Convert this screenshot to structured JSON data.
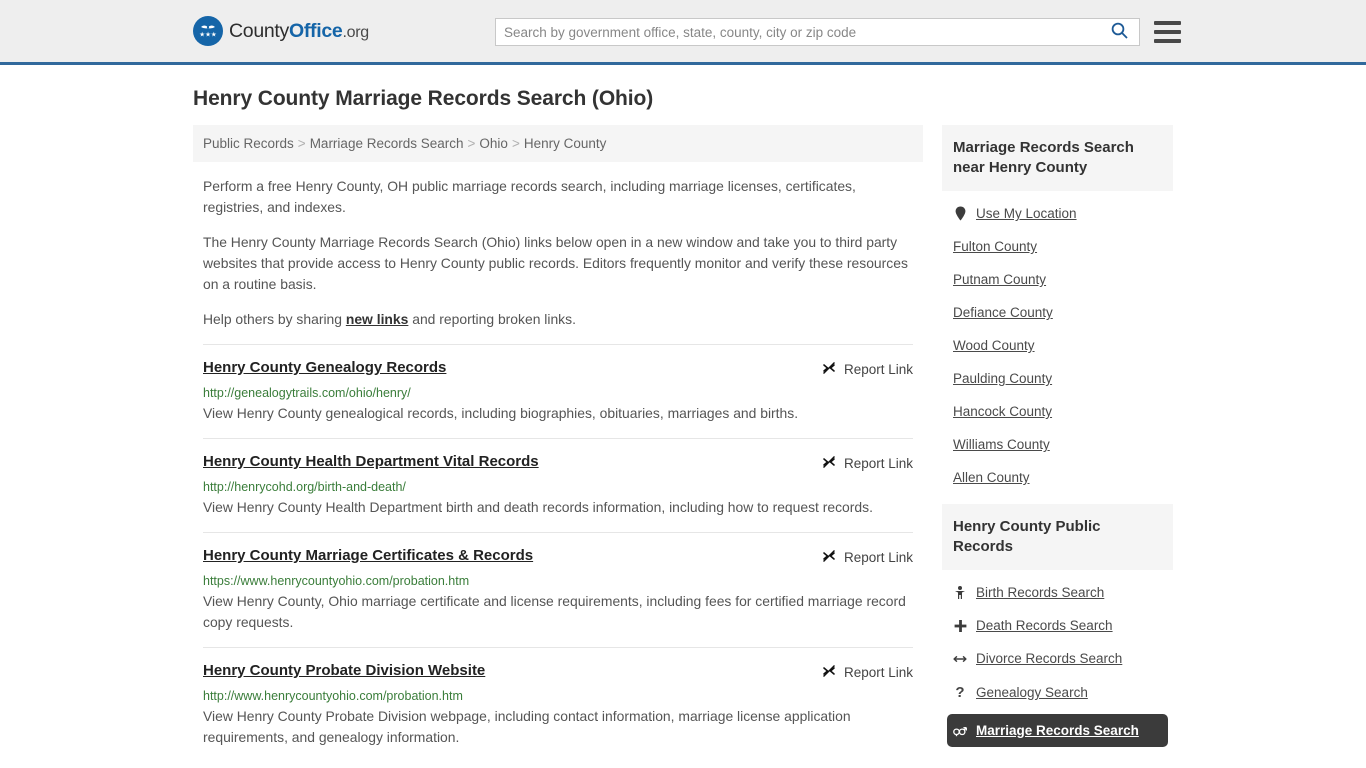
{
  "header": {
    "logo": {
      "part1": "County",
      "part2": "Office",
      "part3": ".org",
      "icon": "eagle-shield-logo"
    },
    "search": {
      "placeholder": "Search by government office, state, county, city or zip code",
      "value": "",
      "search_icon": "search-icon"
    },
    "menu_icon": "hamburger-menu-icon",
    "accent_color": "#31699c"
  },
  "page_title": "Henry County Marriage Records Search (Ohio)",
  "breadcrumb": {
    "separator": ">",
    "items": [
      {
        "label": "Public Records"
      },
      {
        "label": "Marriage Records Search"
      },
      {
        "label": "Ohio"
      },
      {
        "label": "Henry County"
      }
    ]
  },
  "intro": {
    "p1": "Perform a free Henry County, OH public marriage records search, including marriage licenses, certificates, registries, and indexes.",
    "p2": "The Henry County Marriage Records Search (Ohio) links below open in a new window and take you to third party websites that provide access to Henry County public records. Editors frequently monitor and verify these resources on a routine basis.",
    "p3_before": "Help others by sharing ",
    "p3_link": "new links",
    "p3_after": " and reporting broken links."
  },
  "results": {
    "report_label": "Report Link",
    "report_icon": "broken-link-icon",
    "items": [
      {
        "title": "Henry County Genealogy Records",
        "url": "http://genealogytrails.com/ohio/henry/",
        "description": "View Henry County genealogical records, including biographies, obituaries, marriages and births."
      },
      {
        "title": "Henry County Health Department Vital Records",
        "url": "http://henrycohd.org/birth-and-death/",
        "description": "View Henry County Health Department birth and death records information, including how to request records."
      },
      {
        "title": "Henry County Marriage Certificates & Records",
        "url": "https://www.henrycountyohio.com/probation.htm",
        "description": "View Henry County, Ohio marriage certificate and license requirements, including fees for certified marriage record copy requests."
      },
      {
        "title": "Henry County Probate Division Website",
        "url": "http://www.henrycountyohio.com/probation.htm",
        "description": "View Henry County Probate Division webpage, including contact information, marriage license application requirements, and genealogy information."
      }
    ]
  },
  "sidebar": {
    "nearby": {
      "heading": "Marriage Records Search near Henry County",
      "items": [
        {
          "label": "Use My Location",
          "icon": "map-pin-icon",
          "glyph": "•"
        },
        {
          "label": "Fulton County",
          "icon": "",
          "glyph": ""
        },
        {
          "label": "Putnam County",
          "icon": "",
          "glyph": ""
        },
        {
          "label": "Defiance County",
          "icon": "",
          "glyph": ""
        },
        {
          "label": "Wood County",
          "icon": "",
          "glyph": ""
        },
        {
          "label": "Paulding County",
          "icon": "",
          "glyph": ""
        },
        {
          "label": "Hancock County",
          "icon": "",
          "glyph": ""
        },
        {
          "label": "Williams County",
          "icon": "",
          "glyph": ""
        },
        {
          "label": "Allen County",
          "icon": "",
          "glyph": ""
        }
      ]
    },
    "public_records": {
      "heading": "Henry County Public Records",
      "items": [
        {
          "label": "Birth Records Search",
          "icon": "baby-icon",
          "glyph": "",
          "active": false
        },
        {
          "label": "Death Records Search",
          "icon": "cross-icon",
          "glyph": "✚",
          "active": false
        },
        {
          "label": "Divorce Records Search",
          "icon": "left-right-arrow-icon",
          "glyph": "↔",
          "active": false
        },
        {
          "label": "Genealogy Search",
          "icon": "question-mark-icon",
          "glyph": "?",
          "active": false
        },
        {
          "label": "Marriage Records Search",
          "icon": "male-female-icon",
          "glyph": "",
          "active": true
        }
      ]
    }
  }
}
